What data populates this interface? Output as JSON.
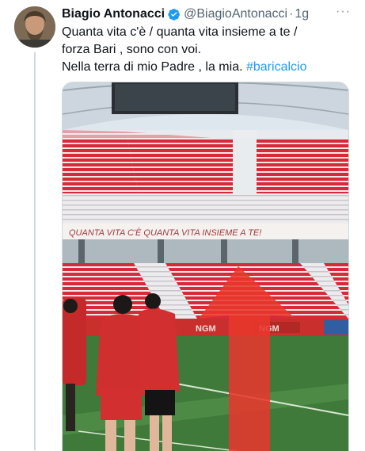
{
  "tweet": {
    "author_name": "Biagio Antonacci",
    "handle": "@BiagioAntonacci",
    "separator": "·",
    "time": "1g",
    "more": "···",
    "lines": [
      "Quanta vita c'è / quanta vita insieme a te /",
      "forza Bari , sono con voi.",
      "Nella terra di mio Padre , la mia."
    ],
    "hashtag": "#baricalcio"
  },
  "media": {
    "banner_text": "QUANTA VITA C'È   QUANTA VITA INSIEME A TE!",
    "ad_text_1": "NGM",
    "ad_text_2": "NGM"
  },
  "colors": {
    "accent": "#1d9bf0",
    "seat_red": "#d8293a",
    "arrow_red": "#e8372c",
    "pitch_green": "#3f7a3a"
  }
}
